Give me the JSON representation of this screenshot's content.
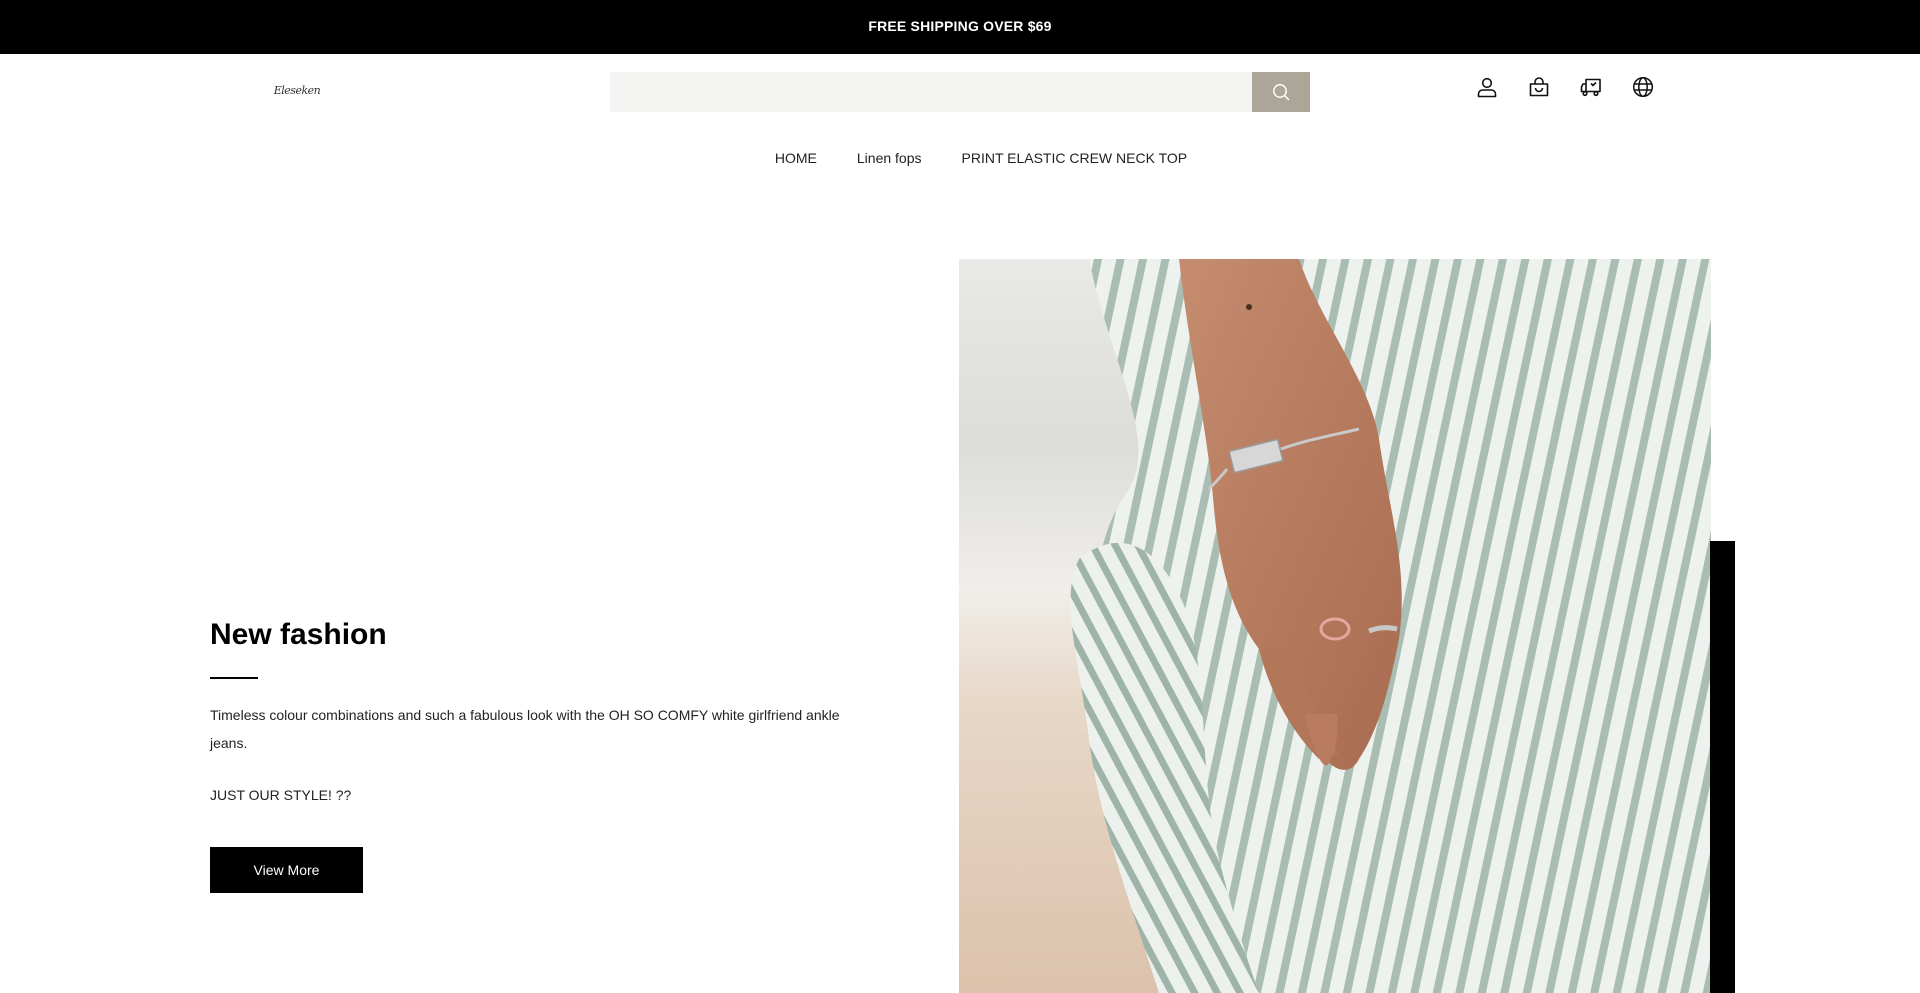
{
  "announcement": {
    "text": "FREE SHIPPING OVER $69"
  },
  "logo": {
    "text": "Eleseken"
  },
  "search": {
    "placeholder": "",
    "value": "",
    "button_icon": "search-icon"
  },
  "header_icons": [
    {
      "name": "account-icon"
    },
    {
      "name": "cart-icon"
    },
    {
      "name": "track-order-icon"
    },
    {
      "name": "language-icon"
    }
  ],
  "nav": {
    "items": [
      {
        "label": "HOME"
      },
      {
        "label": "Linen fops"
      },
      {
        "label": "PRINT ELASTIC CREW NECK TOP"
      }
    ]
  },
  "hero": {
    "title": "New fashion",
    "description": "Timeless colour combinations and such a fabulous look with the OH SO COMFY white girlfriend ankle jeans.",
    "tagline": "JUST OUR STYLE! ??",
    "button_label": "View More"
  },
  "colors": {
    "announcement_bg": "#000000",
    "search_bg": "#f4f4f3",
    "search_button": "#aba698",
    "accent": "#000000"
  }
}
